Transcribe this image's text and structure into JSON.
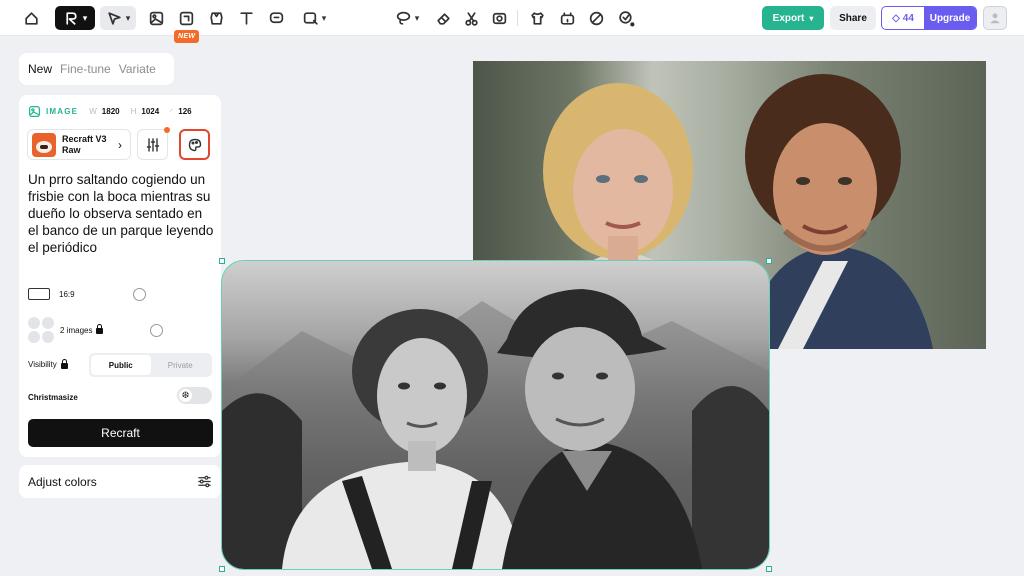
{
  "toolbar": {
    "new_badge": "NEW"
  },
  "actions": {
    "export_label": "Export",
    "share_label": "Share",
    "credits": "44",
    "upgrade_label": "Upgrade"
  },
  "mode_tabs": [
    "New",
    "Fine-tune",
    "Variate"
  ],
  "image_settings": {
    "label": "IMAGE",
    "w_key": "W",
    "width": "1820",
    "h_key": "H",
    "height": "1024",
    "extra": "126"
  },
  "model": {
    "name": "Recraft V3 Raw"
  },
  "prompt": "Un prro saltando cogiendo un frisbie con la boca mientras su dueño lo observa sentado en el banco de un parque leyendo el periódico",
  "aspect_ratio": "16:9",
  "image_count": "2 images",
  "visibility": {
    "label": "Visibility",
    "public": "Public",
    "private": "Private"
  },
  "christmasize_label": "Christmasize",
  "generate_label": "Recraft",
  "adjust_colors_label": "Adjust colors",
  "colors": {
    "accent": "#26b38f",
    "upgrade": "#6b5cf0",
    "new_badge": "#f26b2a"
  }
}
